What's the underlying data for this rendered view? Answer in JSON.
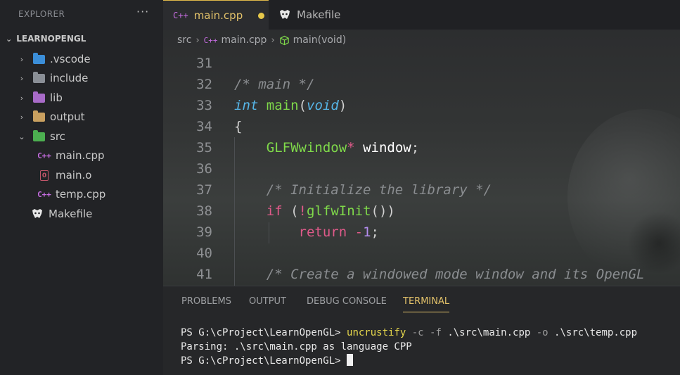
{
  "explorer": {
    "title": "EXPLORER",
    "more": "···",
    "project": "LEARNOPENGL",
    "items": [
      {
        "label": ".vscode",
        "kind": "folder",
        "icon": "vscode-folder-icon",
        "color": "#3b8ed8",
        "chevron": "›"
      },
      {
        "label": "include",
        "kind": "folder",
        "icon": "include-folder-icon",
        "color": "#8a8f96",
        "chevron": "›"
      },
      {
        "label": "lib",
        "kind": "folder",
        "icon": "lib-folder-icon",
        "color": "#a86bc8",
        "chevron": "›"
      },
      {
        "label": "output",
        "kind": "folder",
        "icon": "folder-icon",
        "color": "#c9a060",
        "chevron": "›"
      },
      {
        "label": "src",
        "kind": "folder-open",
        "icon": "src-folder-icon",
        "color": "#4caf50",
        "chevron": "⌄"
      },
      {
        "label": "main.cpp",
        "kind": "cpp",
        "icon": "cpp-file-icon",
        "color": "#c56ce0"
      },
      {
        "label": "main.o",
        "kind": "obj",
        "icon": "object-file-icon",
        "color": "#c2566a"
      },
      {
        "label": "temp.cpp",
        "kind": "cpp",
        "icon": "cpp-file-icon",
        "color": "#c56ce0"
      },
      {
        "label": "Makefile",
        "kind": "make",
        "icon": "makefile-icon",
        "color": "#e8e8e8"
      }
    ]
  },
  "tabs": [
    {
      "label": "main.cpp",
      "icon": "cpp-file-icon",
      "icon_text": "C++",
      "active": true,
      "modified": true
    },
    {
      "label": "Makefile",
      "icon": "makefile-icon",
      "active": false
    }
  ],
  "breadcrumb": {
    "parts": [
      "src",
      "main.cpp",
      "main(void)"
    ],
    "cpp_icon_text": "C++"
  },
  "code": {
    "lines": [
      {
        "n": "31",
        "tokens": []
      },
      {
        "n": "32",
        "tokens": [
          [
            "c-cm",
            "/* main */"
          ]
        ]
      },
      {
        "n": "33",
        "tokens": [
          [
            "c-kw",
            "int"
          ],
          [
            "c-pn",
            " "
          ],
          [
            "c-fn",
            "main"
          ],
          [
            "c-pn",
            "("
          ],
          [
            "c-kw",
            "void"
          ],
          [
            "c-pn",
            ")"
          ]
        ]
      },
      {
        "n": "34",
        "tokens": [
          [
            "c-pn",
            "{"
          ]
        ]
      },
      {
        "n": "35",
        "tokens": [
          [
            "c-pn",
            "    "
          ],
          [
            "c-ty",
            "GLFWwindow"
          ],
          [
            "c-pk",
            "*"
          ],
          [
            "c-pn",
            " "
          ],
          [
            "c-id",
            "window"
          ],
          [
            "c-pn",
            ";"
          ]
        ]
      },
      {
        "n": "36",
        "tokens": []
      },
      {
        "n": "37",
        "tokens": [
          [
            "c-pn",
            "    "
          ],
          [
            "c-cm",
            "/* Initialize the library */"
          ]
        ]
      },
      {
        "n": "38",
        "tokens": [
          [
            "c-pn",
            "    "
          ],
          [
            "c-pk",
            "if"
          ],
          [
            "c-pn",
            " ("
          ],
          [
            "c-pk",
            "!"
          ],
          [
            "c-fn",
            "glfwInit"
          ],
          [
            "c-pn",
            "())"
          ]
        ]
      },
      {
        "n": "39",
        "tokens": [
          [
            "c-pn",
            "        "
          ],
          [
            "c-pk",
            "return"
          ],
          [
            "c-pn",
            " "
          ],
          [
            "c-pk",
            "-"
          ],
          [
            "c-num",
            "1"
          ],
          [
            "c-pn",
            ";"
          ]
        ]
      },
      {
        "n": "40",
        "tokens": []
      },
      {
        "n": "41",
        "tokens": [
          [
            "c-pn",
            "    "
          ],
          [
            "c-cm",
            "/* Create a windowed mode window and its OpenGL"
          ]
        ]
      }
    ]
  },
  "panel": {
    "tabs": [
      {
        "label": "PROBLEMS",
        "active": false
      },
      {
        "label": "OUTPUT",
        "active": false
      },
      {
        "label": "DEBUG CONSOLE",
        "active": false
      },
      {
        "label": "TERMINAL",
        "active": true
      }
    ],
    "terminal": {
      "prompt": "PS G:\\cProject\\LearnOpenGL> ",
      "command": "uncrustify",
      "args": [
        [
          "t-flag",
          " -c "
        ],
        [
          "t-flag",
          "-f"
        ],
        [
          "t-arg",
          " .\\src\\main.cpp "
        ],
        [
          "t-flag",
          "-o"
        ],
        [
          "t-arg",
          " .\\src\\temp.cpp"
        ]
      ],
      "output": "Parsing: .\\src\\main.cpp as language CPP",
      "prompt2": "PS G:\\cProject\\LearnOpenGL> "
    }
  }
}
